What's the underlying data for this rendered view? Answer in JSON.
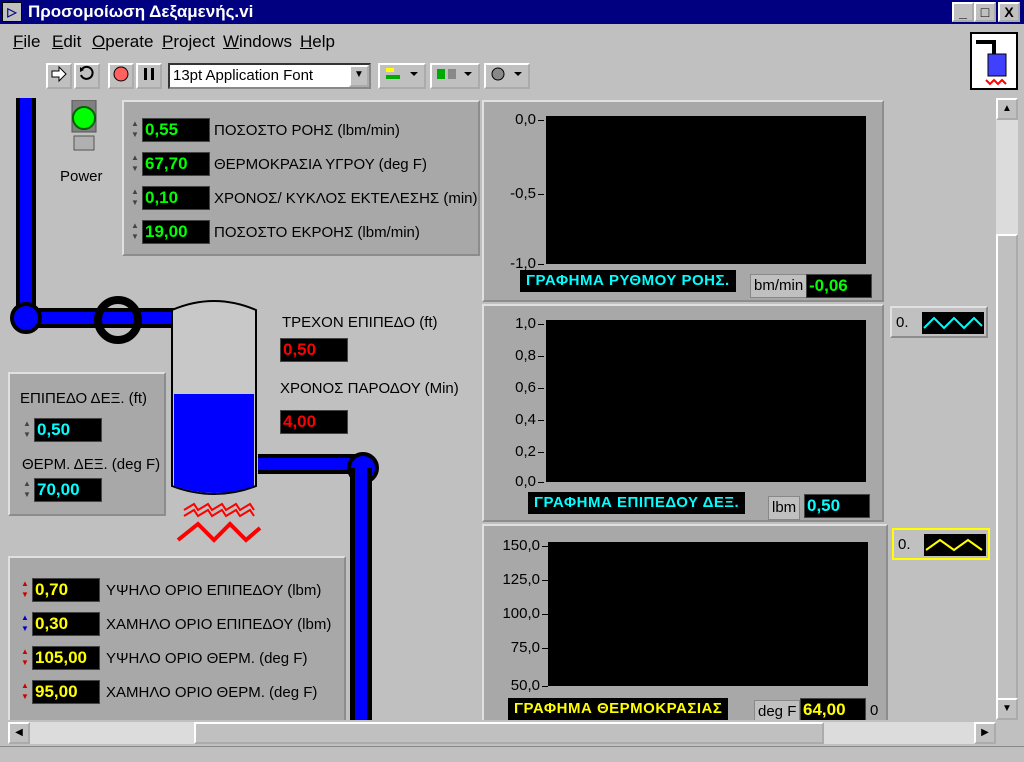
{
  "window": {
    "title": "Προσομοίωση Δεξαμενής.vi",
    "title_icon": "▷",
    "min": "_",
    "max": "□",
    "close": "X"
  },
  "menu": [
    {
      "label": "File",
      "ul": "F",
      "rest": "ile"
    },
    {
      "label": "Edit",
      "ul": "E",
      "rest": "dit"
    },
    {
      "label": "Operate",
      "ul": "O",
      "rest": "perate"
    },
    {
      "label": "Project",
      "ul": "P",
      "rest": "roject"
    },
    {
      "label": "Windows",
      "ul": "W",
      "rest": "indows"
    },
    {
      "label": "Help",
      "ul": "H",
      "rest": "elp"
    }
  ],
  "toolbar": {
    "font": "13pt Application Font"
  },
  "power": {
    "label": "Power"
  },
  "inputs_top": [
    {
      "value": "0,55",
      "label": "ΠΟΣΟΣΤΟ ΡΟΗΣ (lbm/min)"
    },
    {
      "value": "67,70",
      "label": "ΘΕΡΜΟΚΡΑΣΙΑ ΥΓΡΟΥ (deg F)"
    },
    {
      "value": "0,10",
      "label": "ΧΡΟΝΟΣ/ ΚΥΚΛΟΣ ΕΚΤΕΛΕΣΗΣ (min)"
    },
    {
      "value": "19,00",
      "label": "ΠΟΣΟΣΤΟ ΕΚΡΟΗΣ (lbm/min)"
    }
  ],
  "tank": {
    "level_label": "ΤΡΕΧΟΝ ΕΠΙΠΕΔΟ (ft)",
    "level_value": "0,50",
    "time_label": "ΧΡΟΝΟΣ ΠΑΡΟΔΟΥ  (Min)",
    "time_value": "4,00"
  },
  "tank_panel": {
    "level_label": "ΕΠΙΠΕΔΟ ΔΕΞ. (ft)",
    "level_value": "0,50",
    "temp_label": "ΘΕΡΜ. ΔΕΞ. (deg F)",
    "temp_value": "70,00"
  },
  "limits": [
    {
      "value": "0,70",
      "label": "ΥΨΗΛΟ ΟΡΙΟ ΕΠΙΠΕΔΟΥ (lbm)"
    },
    {
      "value": "0,30",
      "label": "ΧΑΜΗΛΟ ΟΡΙΟ ΕΠΙΠΕΔΟΥ (lbm)"
    },
    {
      "value": "105,00",
      "label": "ΥΨΗΛΟ ΟΡΙΟ ΘΕΡΜ. (deg F)"
    },
    {
      "value": "95,00",
      "label": "ΧΑΜΗΛΟ ΟΡΙΟ ΘΕΡΜ. (deg F)"
    }
  ],
  "charts": [
    {
      "title": "ΓΡΑΦΗΜΑ ΡΥΘΜΟΥ ΡΟΗΣ.",
      "unit": "bm/min",
      "value": "-0,06",
      "ticks": [
        "0,0",
        "-0,5",
        "-1,0"
      ],
      "color": "#00ffff"
    },
    {
      "title": "ΓΡΑΦΗΜΑ ΕΠΙΠΕΔΟΥ ΔΕΞ.",
      "unit": "lbm",
      "value": "0,50",
      "ticks": [
        "1,0",
        "0,8",
        "0,6",
        "0,4",
        "0,2",
        "0,0"
      ],
      "color": "#00ffff"
    },
    {
      "title": "ΓΡΑΦΗΜΑ ΘΕΡΜΟΚΡΑΣΙΑΣ",
      "unit": "deg F",
      "value": "64,00",
      "extra": "0",
      "ticks": [
        "150,0",
        "125,0",
        "100,0",
        "75,0",
        "50,0"
      ],
      "color": "#ffff00"
    }
  ],
  "legends": [
    {
      "value": "0.",
      "color": "#00ffff"
    },
    {
      "value": "0.",
      "color": "#ffff00"
    }
  ],
  "colors": {
    "pipe": "#0000ff",
    "water": "#0000ff",
    "heater": "#ff0000",
    "led": "#00ff00"
  }
}
